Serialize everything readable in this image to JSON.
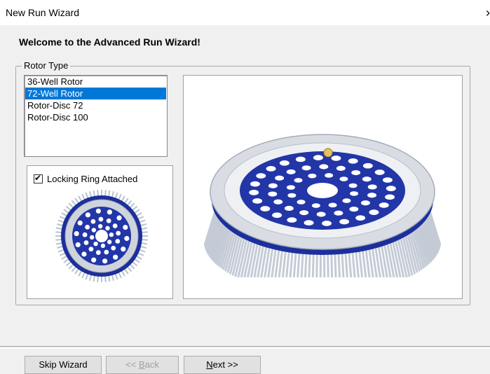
{
  "window": {
    "title": "New Run Wizard",
    "close_glyph": "›"
  },
  "welcome": "Welcome to the Advanced Run Wizard!",
  "rotor_group": {
    "legend": "Rotor Type",
    "items": [
      {
        "label": "36-Well Rotor",
        "selected": false
      },
      {
        "label": "72-Well Rotor",
        "selected": true
      },
      {
        "label": "Rotor-Disc 72",
        "selected": false
      },
      {
        "label": "Rotor-Disc 100",
        "selected": false
      }
    ],
    "locking_ring": {
      "label": "Locking Ring Attached",
      "checked": true
    }
  },
  "buttons": {
    "skip": "Skip Wizard",
    "back_prefix": "<< ",
    "back_accel": "B",
    "back_rest": "ack",
    "next_accel": "N",
    "next_rest": "ext >>"
  },
  "colors": {
    "rotor_blue": "#1c2f9c",
    "selection": "#0078d7"
  }
}
